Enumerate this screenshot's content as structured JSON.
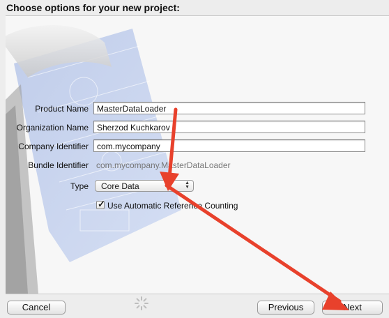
{
  "dialog": {
    "title": "Choose options for your new project:"
  },
  "form": {
    "product_name": {
      "label": "Product Name",
      "value": "MasterDataLoader"
    },
    "organization_name": {
      "label": "Organization Name",
      "value": "Sherzod Kuchkarov"
    },
    "company_identifier": {
      "label": "Company Identifier",
      "value": "com.mycompany"
    },
    "bundle_identifier": {
      "label": "Bundle Identifier",
      "value": "com.mycompany.MasterDataLoader"
    },
    "type": {
      "label": "Type",
      "value": "Core Data"
    },
    "arc": {
      "label": "Use Automatic Reference Counting",
      "checked": true
    }
  },
  "buttons": {
    "cancel": "Cancel",
    "previous": "Previous",
    "next": "Next"
  },
  "annotations": {
    "arrow_color": "#e8412c"
  },
  "icons": [
    "xcode-hammer-blueprint-icon",
    "chevron-updown-icon",
    "checkmark-icon",
    "progress-spinner-icon"
  ]
}
